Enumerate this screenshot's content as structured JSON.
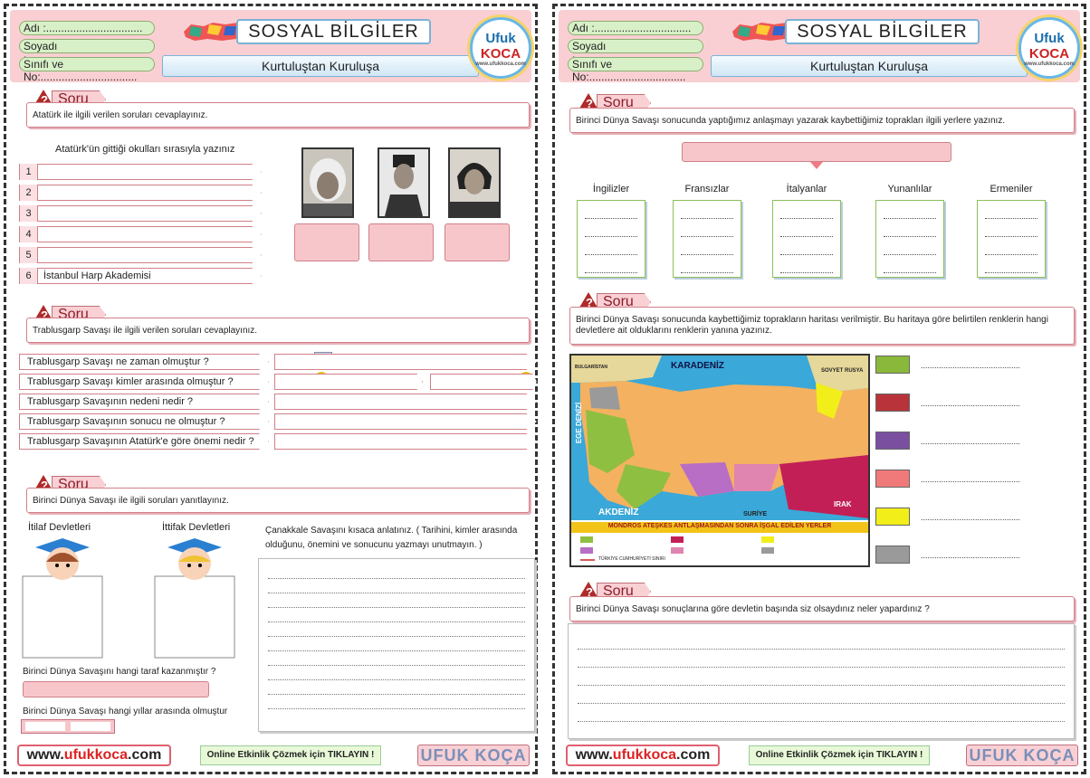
{
  "header": {
    "name_label": "Adı :",
    "surname_label": "Soyadı :",
    "class_label": "Sınıfı ve No:",
    "dots": "................................",
    "title": "SOSYAL BİLGİLER",
    "subtitle": "Kurtuluştan Kuruluşa",
    "logo_top": "Ufuk",
    "logo_bottom": "KOCA",
    "logo_site": "www.ufukkoca.com"
  },
  "soru_label": "Soru",
  "soru_mark": "?",
  "page1": {
    "q1": {
      "prompt": "Atatürk ile ilgili verilen soruları cevaplayınız.",
      "schools_title": "Atatürk'ün gittiği okulları sırasıyla yazınız",
      "rows": [
        {
          "n": "1",
          "text": ""
        },
        {
          "n": "2",
          "text": ""
        },
        {
          "n": "3",
          "text": ""
        },
        {
          "n": "4",
          "text": ""
        },
        {
          "n": "5",
          "text": ""
        },
        {
          "n": "6",
          "text": "İstanbul Harp Akademisi"
        }
      ]
    },
    "q2": {
      "prompt": "Trablusgarp Savaşı ile ilgili verilen soruları cevaplayınız.",
      "rows": [
        "Trablusgarp Savaşı ne zaman olmuştur ?",
        "Trablusgarp Savaşı kimler arasında olmuştur ?",
        "Trablusgarp Savaşının nedeni nedir ?",
        "Trablusgarp Savaşının sonucu ne olmuştur ?",
        "Trablusgarp Savaşının Atatürk'e göre önemi nedir ?"
      ]
    },
    "q3": {
      "prompt": "Birinci Dünya Savaşı ile ilgili soruları yanıtlayınız.",
      "itilaf": "İtilaf Devletleri",
      "ittifak": "İttifak Devletleri",
      "canakkale": "Çanakkale Savaşını kısaca anlatınız. ( Tarihini, kimler arasında olduğunu, önemini ve sonucunu yazmayı unutmayın. )",
      "winner_q": "Birinci Dünya Savaşını hangi taraf kazanmıştır ?",
      "years_q": "Birinci Dünya Savaşı hangi yıllar arasında olmuştur"
    }
  },
  "page2": {
    "q1": {
      "prompt": "Birinci Dünya Savaşı sonucunda yaptığımız anlaşmayı yazarak kaybettiğimiz toprakları ilgili yerlere yazınız.",
      "columns": [
        "İngilizler",
        "Fransızlar",
        "İtalyanlar",
        "Yunanlılar",
        "Ermeniler"
      ]
    },
    "q2": {
      "prompt": "Birinci Dünya Savaşı sonucunda kaybettiğimiz toprakların haritası verilmiştir. Bu haritaya göre belirtilen renklerin hangi devletlere ait olduklarını renklerin yanına yazınız.",
      "answer_dots": "............................................",
      "map": {
        "karadeniz": "KARADENİZ",
        "akdeniz": "AKDENİZ",
        "ege": "EGE DENİZİ",
        "suriye": "SURİYE",
        "irak": "IRAK",
        "bulgaristan": "BULGARİSTAN",
        "sovyet": "SOVYET RUSYA",
        "caption": "MONDROS ATEŞKES ANTLAŞMASINDAN SONRA İŞGAL EDİLEN YERLER",
        "border": "TÜRKİYE CUMHURİYETİ SINIRI"
      },
      "swatches": [
        "#8ab83a",
        "#b8343a",
        "#7a4fa0",
        "#f07a7a",
        "#f2ee1a",
        "#9a9a9a"
      ]
    },
    "q3": {
      "prompt": "Birinci Dünya Savaşı sonuçlarına göre devletin başında siz olsaydınız neler yapardınız ?"
    }
  },
  "footer": {
    "url_prefix": "www.",
    "url_brand": "ufukkoca",
    "url_suffix": ".com",
    "online": "Online Etkinlik Çözmek için TIKLAYIN !",
    "brand": "UFUK KOÇA"
  }
}
